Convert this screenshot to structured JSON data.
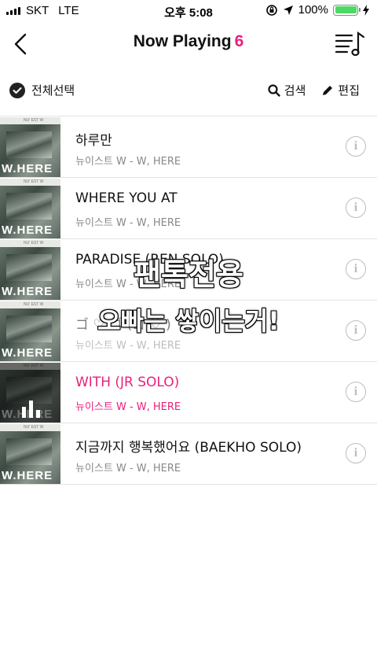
{
  "status_bar": {
    "carrier": "SKT",
    "network": "LTE",
    "time": "오후 5:08",
    "battery_text": "100%",
    "battery_color": "#4cd964"
  },
  "header": {
    "title": "Now Playing",
    "count": "6",
    "accent_color": "#ea1f7b",
    "back_icon": "chevron-left-icon",
    "playlist_icon": "playlist-music-icon"
  },
  "toolbar": {
    "select_all_label": "전체선택",
    "search_label": "검색",
    "edit_label": "편집"
  },
  "songs": [
    {
      "title": "하루만",
      "artist": "뉴이스트 W - W, HERE",
      "playing": false
    },
    {
      "title": "WHERE YOU AT",
      "artist": "뉴이스트 W - W, HERE",
      "playing": false
    },
    {
      "title": "PARADISE (REN SOLO)",
      "artist": "뉴이스트 W - W, HERE",
      "playing": false
    },
    {
      "title": "ゴ ♡ ゴ  (ゴ ♡ )",
      "artist": "뉴이스트 W - W, HERE",
      "playing": false
    },
    {
      "title": "WITH (JR SOLO)",
      "artist": "뉴이스트 W - W, HERE",
      "playing": true
    },
    {
      "title": "지금까지 행복했어요 (BAEKHO SOLO)",
      "artist": "뉴이스트 W - W, HERE",
      "playing": false
    }
  ],
  "album_art": {
    "wordmark": "W.HERE",
    "band_text": "NU' EST W"
  },
  "overlay": {
    "line1": "팬톡전용",
    "line2": "오빠는 쌓이는거!"
  }
}
